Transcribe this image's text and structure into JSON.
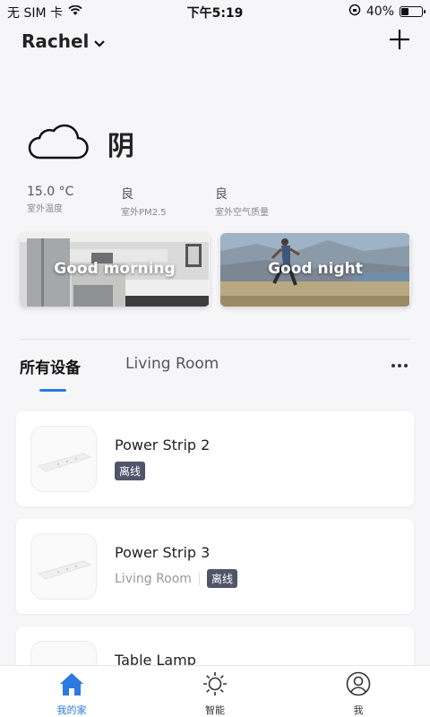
{
  "status_bar": {
    "carrier": "无 SIM 卡",
    "time": "下午5:19",
    "battery": "40%",
    "battery_level": 0.4
  },
  "header": {
    "home_name": "Rachel",
    "add_icon": "plus-icon"
  },
  "weather": {
    "icon": "cloud-icon",
    "condition": "阴",
    "metrics": [
      {
        "value": "15.0 °C",
        "label": "室外温度"
      },
      {
        "value": "良",
        "label": "室外PM2.5"
      },
      {
        "value": "良",
        "label": "室外空气质量"
      }
    ]
  },
  "scenes": [
    {
      "title": "Good morning"
    },
    {
      "title": "Good night"
    }
  ],
  "tabs": {
    "all_devices": "所有设备",
    "room": "Living Room"
  },
  "devices": [
    {
      "name": "Power Strip 2",
      "room": "",
      "status": "离线"
    },
    {
      "name": "Power Strip 3",
      "room": "Living Room",
      "status": "离线"
    },
    {
      "name": "Table Lamp",
      "room": "",
      "status": ""
    }
  ],
  "bottom_nav": [
    {
      "label": "我的家",
      "icon": "home-icon",
      "active": true
    },
    {
      "label": "智能",
      "icon": "sun-icon",
      "active": false
    },
    {
      "label": "我",
      "icon": "user-icon",
      "active": false
    }
  ],
  "colors": {
    "accent": "#2a7ae2",
    "badge": "#505569"
  }
}
